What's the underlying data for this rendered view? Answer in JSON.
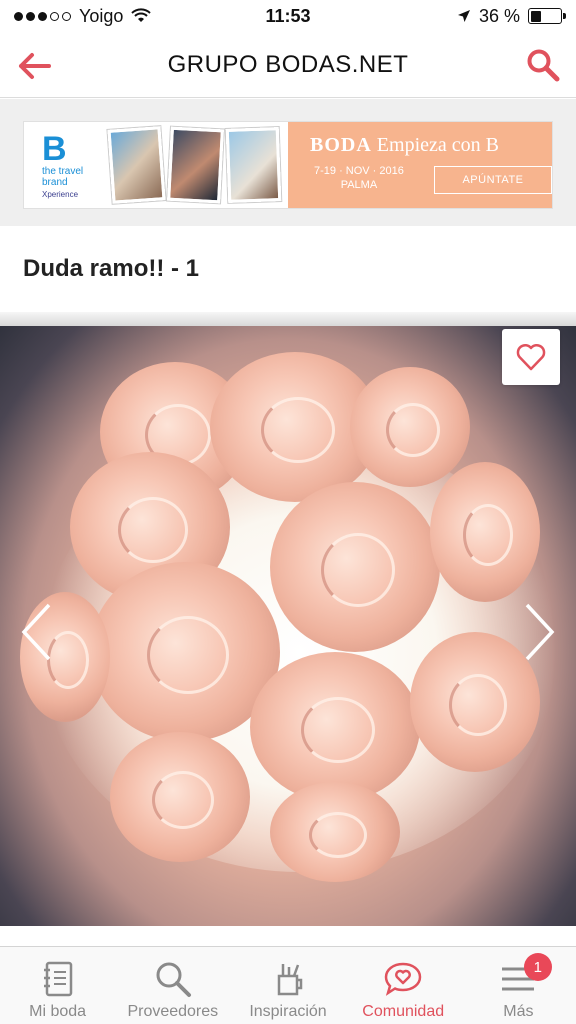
{
  "status_bar": {
    "carrier": "Yoigo",
    "time": "11:53",
    "battery": "36 %",
    "battery_level": 0.36
  },
  "header": {
    "title": "GRUPO BODAS.NET",
    "accent_color": "#e0525d"
  },
  "ad": {
    "logo_letter": "B",
    "brand_line1": "the travel",
    "brand_line2": "brand",
    "brand_sub": "Xperience",
    "headline_bold": "BODA",
    "headline_rest": "Empieza con B",
    "dates": "7-19 · NOV · 2016",
    "city": "PALMA",
    "cta": "APÚNTATE"
  },
  "post": {
    "title": "Duda ramo!! - 1"
  },
  "nav": {
    "items": [
      {
        "label": "Mi boda",
        "icon": "notebook-icon"
      },
      {
        "label": "Proveedores",
        "icon": "search-icon"
      },
      {
        "label": "Inspiración",
        "icon": "pencil-cup-icon"
      },
      {
        "label": "Comunidad",
        "icon": "chat-heart-icon",
        "active": true
      },
      {
        "label": "Más",
        "icon": "menu-icon",
        "badge": "1"
      }
    ]
  }
}
